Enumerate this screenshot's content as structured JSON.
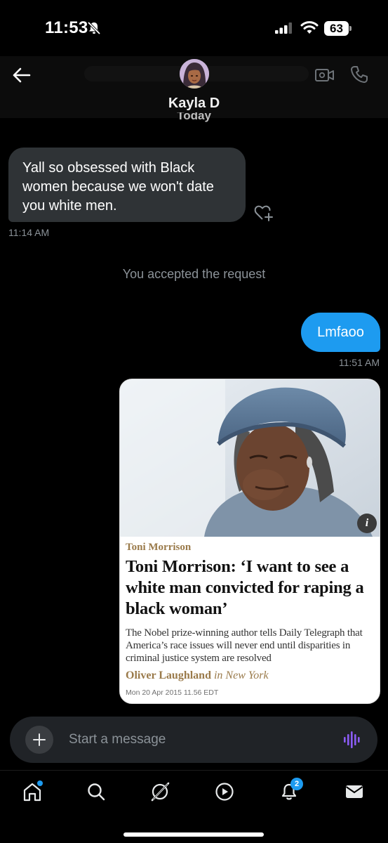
{
  "status_bar": {
    "time": "11:53",
    "battery": "63"
  },
  "header": {
    "contact_name": "Kayla D",
    "day_label": "Today"
  },
  "messages": {
    "incoming": {
      "text": "Yall so obsessed with Black women because we won't date you white men.",
      "time": "11:14 AM"
    },
    "system_note": "You accepted the request",
    "outgoing": {
      "text": "Lmfaoo",
      "time": "11:51 AM"
    }
  },
  "shared_article": {
    "kicker": "Toni Morrison",
    "headline": "Toni Morrison: ‘I want to see a white man convicted for raping a black woman’",
    "standfirst": "The Nobel prize-winning author tells Daily Telegraph that America’s race issues will never end until disparities in criminal justice system are resolved",
    "byline_name": "Oliver Laughland",
    "byline_location": "in New York",
    "date": "Mon 20 Apr 2015 11.56 EDT",
    "info_icon": "i"
  },
  "composer": {
    "placeholder": "Start a message"
  },
  "tab_bar": {
    "notifications_badge": "2"
  },
  "colors": {
    "accent": "#1d9bf0",
    "bubble_in": "#2f3336",
    "voice": "#8b5cf6"
  },
  "icons": [
    "back-arrow-icon",
    "bell-off-icon",
    "signal-icon",
    "wifi-icon",
    "video-icon",
    "phone-icon",
    "add-reaction-icon",
    "plus-icon",
    "voice-icon",
    "home-icon",
    "search-icon",
    "grok-icon",
    "video-play-icon",
    "bell-icon",
    "mail-icon"
  ]
}
